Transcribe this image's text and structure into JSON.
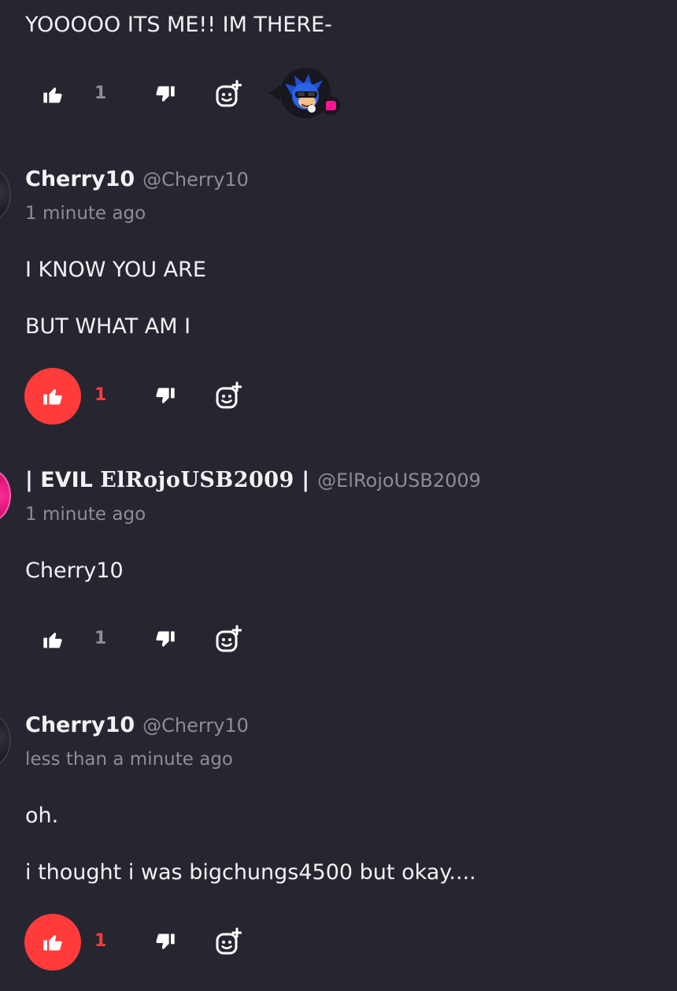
{
  "comments": [
    {
      "lines": [
        "YOOOOO ITS ME!! IM THERE-"
      ],
      "likes": "1",
      "liked": false,
      "reaction_icon": "sonic-sunglasses-avatar"
    },
    {
      "author": "Cherry10",
      "handle": "@Cherry10",
      "time": "1 minute ago",
      "lines": [
        "I KNOW YOU ARE",
        "BUT WHAT AM I"
      ],
      "likes": "1",
      "liked": true
    },
    {
      "author_prefix": "| EVIL ",
      "author_mono": "ElRojoUSB2009",
      "author_suffix": " |",
      "handle": "@ElRojoUSB2009",
      "time": "1 minute ago",
      "lines": [
        "Cherry10"
      ],
      "likes": "1",
      "liked": false
    },
    {
      "author": "Cherry10",
      "handle": "@Cherry10",
      "time": "less than a minute ago",
      "lines": [
        "oh.",
        "i thought i was bigchungs4500 but okay...."
      ],
      "likes": "1",
      "liked": true
    }
  ],
  "colors": {
    "background": "#262630",
    "accent": "#ff3b3b",
    "muted": "#8d8d98",
    "text": "#f2f2f4",
    "notification": "#ff1493"
  },
  "icons": {
    "like": "thumbs-up-icon",
    "dislike": "thumbs-down-icon",
    "react": "add-reaction-icon"
  }
}
